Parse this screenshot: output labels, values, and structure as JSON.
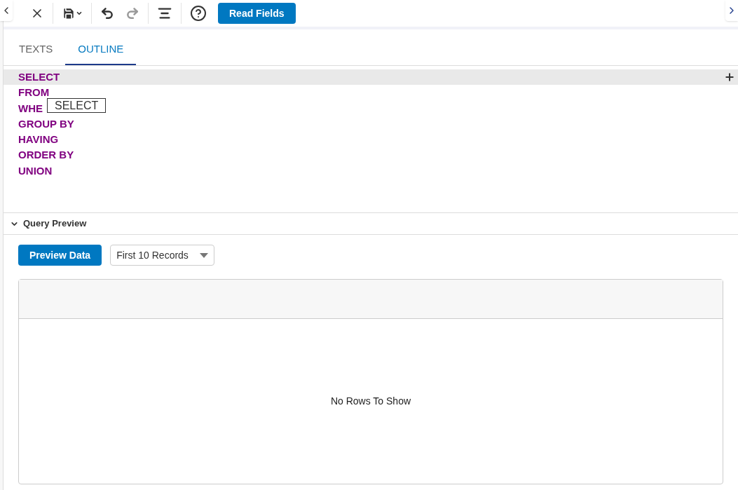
{
  "toolbar": {
    "read_fields": "Read Fields"
  },
  "tabs": [
    {
      "label": "TEXTS",
      "selected": false
    },
    {
      "label": "OUTLINE",
      "selected": true
    }
  ],
  "outline": {
    "items": [
      {
        "label": "SELECT",
        "selected": true
      },
      {
        "label": "FROM",
        "selected": false
      },
      {
        "label": "WHE",
        "selected": false
      },
      {
        "label": "GROUP BY",
        "selected": false
      },
      {
        "label": "HAVING",
        "selected": false
      },
      {
        "label": "ORDER BY",
        "selected": false
      },
      {
        "label": "UNION",
        "selected": false
      }
    ],
    "tooltip": "SELECT"
  },
  "query_preview": {
    "title": "Query Preview",
    "expanded": true,
    "preview_button": "Preview Data",
    "records_select": "First 10 Records",
    "empty_message": "No Rows To Show"
  }
}
